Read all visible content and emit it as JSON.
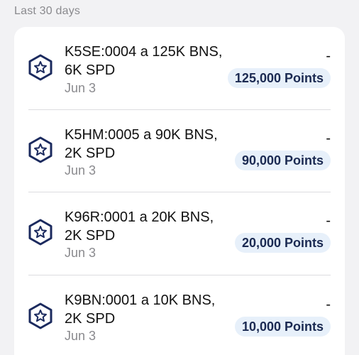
{
  "section": {
    "label": "Last 30 days"
  },
  "transactions": [
    {
      "title": "K5SE:0004 a 125K BNS, 6K SPD",
      "date": "Jun 3",
      "amount": "-",
      "points": "125,000 Points",
      "icon": "star-hexagon-icon"
    },
    {
      "title": "K5HM:0005 a 90K BNS, 2K SPD",
      "date": "Jun 3",
      "amount": "-",
      "points": "90,000 Points",
      "icon": "star-hexagon-icon"
    },
    {
      "title": "K96R:0001 a 20K BNS, 2K SPD",
      "date": "Jun 3",
      "amount": "-",
      "points": "20,000 Points",
      "icon": "star-hexagon-icon"
    },
    {
      "title": "K9BN:0001 a 10K BNS, 2K SPD",
      "date": "Jun 3",
      "amount": "-",
      "points": "10,000 Points",
      "icon": "star-hexagon-icon"
    }
  ],
  "colors": {
    "icon": "#1b2a5e",
    "points_badge_bg": "#e7f0fa",
    "points_text": "#1b2a52"
  }
}
